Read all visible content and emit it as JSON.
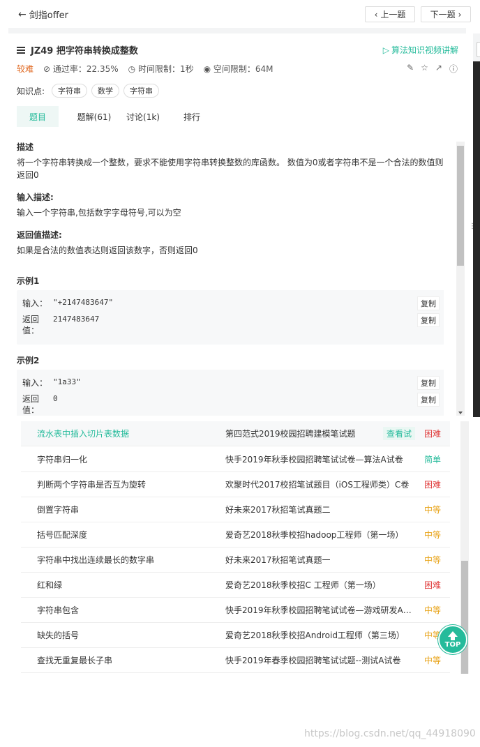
{
  "header": {
    "back_label": "剑指offer",
    "prev_label": "上一题",
    "next_label": "下一题"
  },
  "problem": {
    "title": "JZ49  把字符串转换成整数",
    "video_link": "算法知识视频讲解",
    "difficulty": "较难",
    "pass_rate": "通过率：22.35%",
    "time_limit": "时间限制：1秒",
    "space_limit": "空间限制：64M",
    "tags_label": "知识点:",
    "tags": [
      "字符串",
      "数学",
      "字符串"
    ]
  },
  "tabs": [
    "题目",
    "题解(61)",
    "讨论(1k)",
    "排行"
  ],
  "description": {
    "desc_heading": "描述",
    "desc_text": "将一个字符串转换成一个整数，要求不能使用字符串转换整数的库函数。 数值为0或者字符串不是一个合法的数值则返回0",
    "input_heading": "输入描述:",
    "input_text": "输入一个字符串,包括数字字母符号,可以为空",
    "output_heading": "返回值描述:",
    "output_text": "如果是合法的数值表达则返回该数字，否则返回0"
  },
  "examples": [
    {
      "heading": "示例1",
      "input_label": "输入：",
      "input": "\"+2147483647\"",
      "return_label": "返回值：",
      "return": "2147483647",
      "copy": "复制"
    },
    {
      "heading": "示例2",
      "input_label": "输入：",
      "input": "\"1a33\"",
      "return_label": "返回值：",
      "return": "0",
      "copy": "复制"
    }
  ],
  "related": [
    {
      "name": "流水表中插入切片表数据",
      "source": "第四范式2019校园招聘建模笔试题",
      "badge": "查看试",
      "difficulty": "困难"
    },
    {
      "name": "字符串归一化",
      "source": "快手2019年秋季校园招聘笔试试卷—算法A试卷",
      "difficulty": "简单"
    },
    {
      "name": "判断两个字符串是否互为旋转",
      "source": "欢聚时代2017校招笔试题目（iOS工程师类）C卷",
      "difficulty": "困难"
    },
    {
      "name": "倒置字符串",
      "source": "好未来2017秋招笔试真题二",
      "difficulty": "中等"
    },
    {
      "name": "括号匹配深度",
      "source": "爱奇艺2018秋季校招hadoop工程师（第一场）",
      "difficulty": "中等"
    },
    {
      "name": "字符串中找出连续最长的数字串",
      "source": "好未来2017秋招笔试真题一",
      "difficulty": "中等"
    },
    {
      "name": "红和绿",
      "source": "爱奇艺2018秋季校招C 工程师（第一场）",
      "difficulty": "困难"
    },
    {
      "name": "字符串包含",
      "source": "快手2019年秋季校园招聘笔试试卷—游戏研发A…",
      "difficulty": "中等"
    },
    {
      "name": "缺失的括号",
      "source": "爱奇艺2018秋季校招Android工程师（第三场）",
      "difficulty": "中等"
    },
    {
      "name": "查找无重复最长子串",
      "source": "快手2019年春季校园招聘笔试试题--测试A试卷",
      "difficulty": "中等"
    }
  ],
  "top_button": "TOP",
  "watermark": "https://blog.csdn.net/qq_44918090",
  "colors": {
    "accent": "#25bb9b",
    "hard": "#e03b3b",
    "medium": "#e8a317",
    "difficulty_label": "#e0671f"
  }
}
